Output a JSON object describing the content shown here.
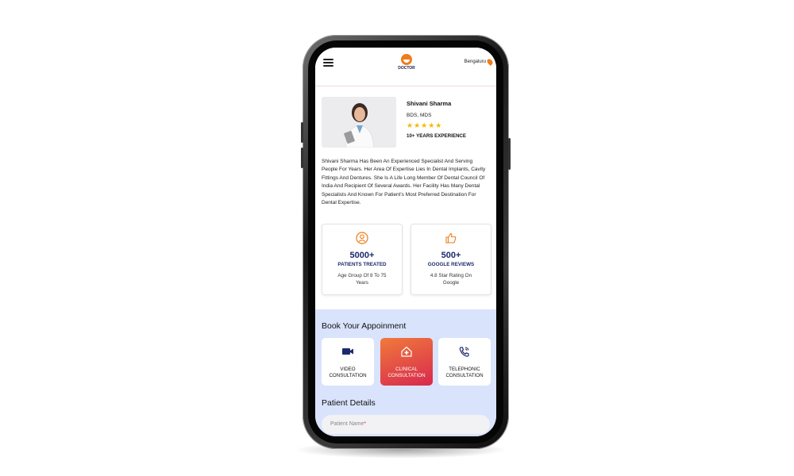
{
  "header": {
    "menu_icon": "hamburger-icon",
    "logo_text": "DOCTOR",
    "location": "Bengaluru",
    "location_icon": "map-pin-icon"
  },
  "doctor": {
    "name": "Shivani Sharma",
    "degree": "BDS, MDS",
    "stars": "★★★★★",
    "experience": "10+ YEARS EXPERIENCE",
    "bio": "Shivani Sharma Has Been An Experienced Specialist And Serving People For Years. Her Area Of Expertise Lies In Dental Implants, Cavity Fittings And Dentures. She Is A Life Long Member Of Dental Council Of India And Recipient Of Several Awards. Her Facility Has Many Dental Specialists And Known For Patient's Most Preferred Destination For Dental Expertise."
  },
  "stats": [
    {
      "icon": "user-circle-icon",
      "number": "5000+",
      "label": "PATIENTS TREATED",
      "sub": "Age Group Of 8 To 75 Years"
    },
    {
      "icon": "thumbs-up-icon",
      "number": "500+",
      "label": "GOOGLE REVIEWS",
      "sub": "4.8 Star Rating On Google"
    }
  ],
  "booking": {
    "title": "Book Your Appoinment",
    "options": [
      {
        "icon": "video-camera-icon",
        "label_line1": "VIDEO",
        "label_line2": "CONSULTATION"
      },
      {
        "icon": "clinic-icon",
        "label_line1": "CLINICAL",
        "label_line2": "CONSULTATION"
      },
      {
        "icon": "phone-icon",
        "label_line1": "TELEPHONIC",
        "label_line2": "CONSULTATION"
      }
    ],
    "selected": "CLINICAL CONSULTATION"
  },
  "patient": {
    "title": "Patient Details",
    "name_placeholder": "Patient Name",
    "required_mark": "*"
  },
  "colors": {
    "accent": "#f07c1a",
    "navy": "#1c2a6b",
    "panel": "#d9e3fb",
    "active_start": "#f07a3a",
    "active_end": "#d8284f"
  }
}
